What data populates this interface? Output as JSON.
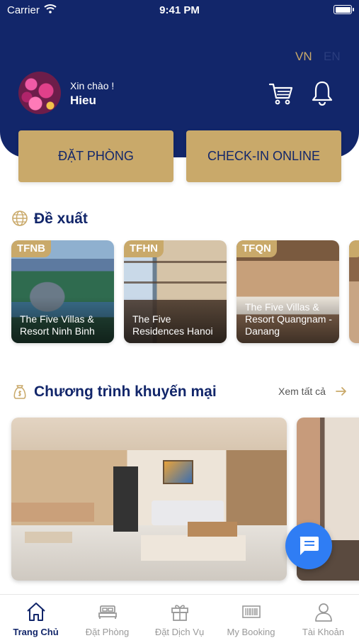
{
  "status_bar": {
    "carrier": "Carrier",
    "time": "9:41 PM"
  },
  "header": {
    "lang_vn": "VN",
    "lang_en": "EN",
    "greeting": "Xin chào !",
    "username": "Hieu",
    "icons": [
      "cart-icon",
      "bell-icon"
    ]
  },
  "actions": {
    "book_label": "ĐẶT PHÒNG",
    "checkin_label": "CHECK-IN ONLINE"
  },
  "suggest": {
    "title": "Đề xuất",
    "hotels": [
      {
        "tag": "TFNB",
        "name": "The Five Villas & Resort Ninh Binh"
      },
      {
        "tag": "TFHN",
        "name": "The Five Residences Hanoi"
      },
      {
        "tag": "TFQN",
        "name": "The Five Villas & Resort Quangnam - Danang"
      }
    ]
  },
  "promo": {
    "title": "Chương trình khuyến mại",
    "see_all": "Xem tất cả"
  },
  "tabs": [
    {
      "label": "Trang Chủ",
      "icon": "home-icon",
      "active": true
    },
    {
      "label": "Đặt Phòng",
      "icon": "bed-icon",
      "active": false
    },
    {
      "label": "Đặt Dịch Vụ",
      "icon": "gift-icon",
      "active": false
    },
    {
      "label": "My Booking",
      "icon": "barcode-icon",
      "active": false
    },
    {
      "label": "Tài Khoản",
      "icon": "user-icon",
      "active": false
    }
  ],
  "colors": {
    "navy": "#12266a",
    "gold": "#c9a96a",
    "chat_blue": "#2f7df4"
  }
}
